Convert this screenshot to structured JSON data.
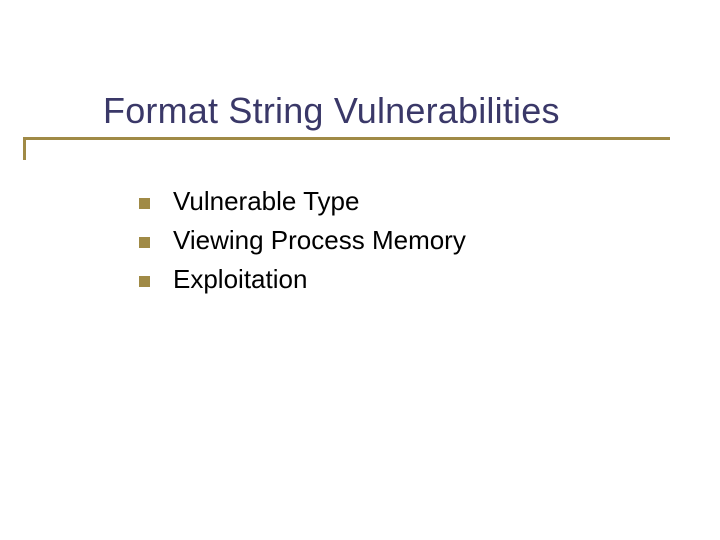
{
  "title": "Format String Vulnerabilities",
  "bullets": [
    {
      "text": "Vulnerable Type"
    },
    {
      "text": "Viewing Process Memory"
    },
    {
      "text": "Exploitation"
    }
  ],
  "colors": {
    "title": "#3a3868",
    "accent": "#a08a46",
    "body": "#000000",
    "background": "#ffffff"
  }
}
